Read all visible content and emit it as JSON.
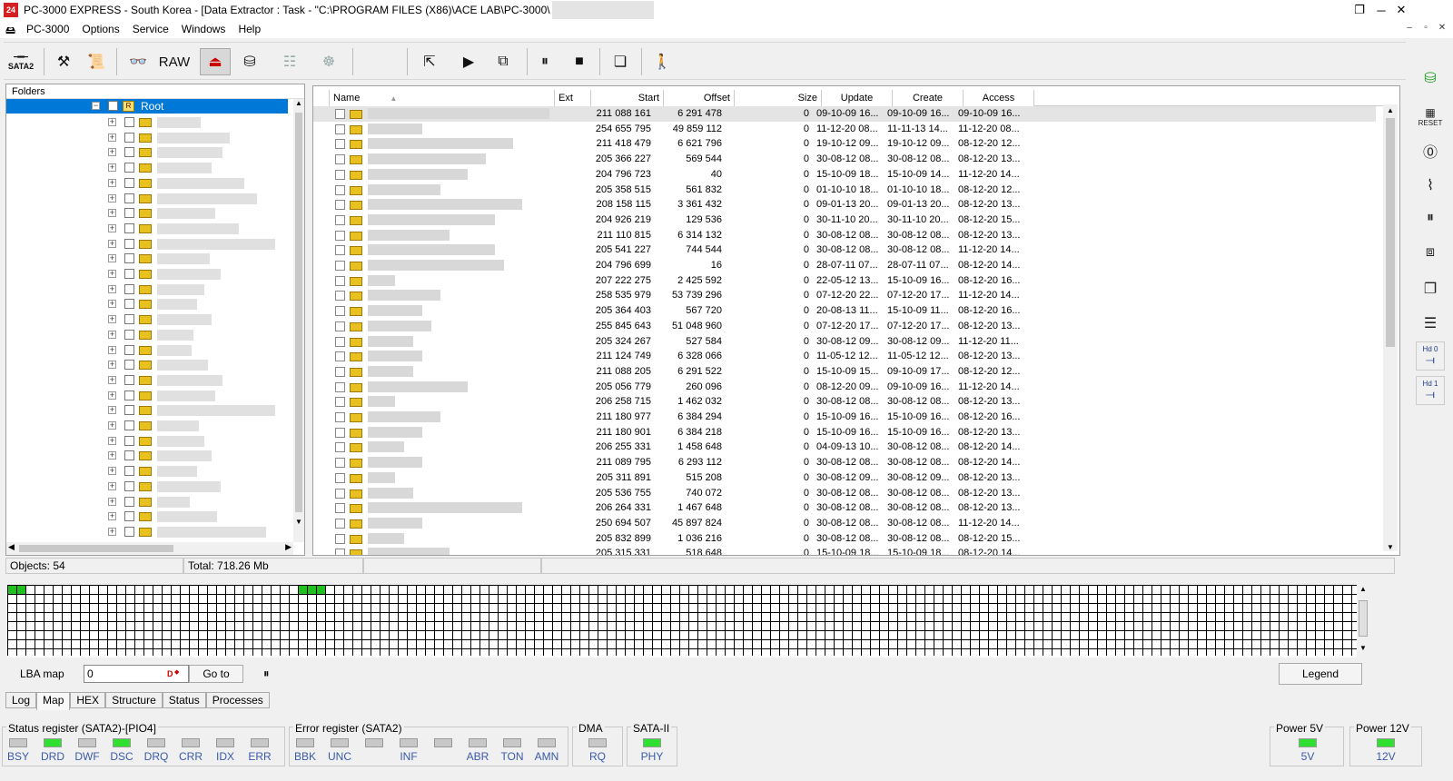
{
  "window": {
    "title": "PC-3000 EXPRESS - South Korea - [Data Extractor : Task - \"C:\\PROGRAM FILES (X86)\\ACE LAB\\PC-3000\\",
    "app_icon": "app-icon",
    "buttons": [
      "minimize",
      "restore",
      "close"
    ]
  },
  "menu": {
    "items": [
      "PC-3000",
      "Options",
      "Service",
      "Windows",
      "Help"
    ]
  },
  "toolbar": {
    "sata2_label": "SATA2",
    "raw_label": "RAW"
  },
  "right_toolbar": {
    "reset_label": "RESET",
    "hd0_label": "Hd 0",
    "hd1_label": "Hd 1"
  },
  "folders": {
    "header": "Folders",
    "root_label": "Root",
    "item_count": 29
  },
  "files": {
    "columns": [
      "Name",
      "Ext",
      "Start",
      "Offset",
      "Size",
      "Update",
      "Create",
      "Access"
    ],
    "rows": [
      [
        "211 088 161",
        "6 291 478",
        "0",
        "09-10-09 16...",
        "09-10-09 16...",
        "09-10-09 16..."
      ],
      [
        "254 655 795",
        "49 859 112",
        "0",
        "11-12-20 08...",
        "11-11-13 14...",
        "11-12-20 08..."
      ],
      [
        "211 418 479",
        "6 621 796",
        "0",
        "19-10-12 09...",
        "19-10-12 09...",
        "08-12-20 12..."
      ],
      [
        "205 366 227",
        "569 544",
        "0",
        "30-08-12 08...",
        "30-08-12 08...",
        "08-12-20 13..."
      ],
      [
        "204 796 723",
        "40",
        "0",
        "15-10-09 18...",
        "15-10-09 14...",
        "11-12-20 14..."
      ],
      [
        "205 358 515",
        "561 832",
        "0",
        "01-10-10 18...",
        "01-10-10 18...",
        "08-12-20 12..."
      ],
      [
        "208 158 115",
        "3 361 432",
        "0",
        "09-01-13 20...",
        "09-01-13 20...",
        "08-12-20 13..."
      ],
      [
        "204 926 219",
        "129 536",
        "0",
        "30-11-10 20...",
        "30-11-10 20...",
        "08-12-20 15..."
      ],
      [
        "211 110 815",
        "6 314 132",
        "0",
        "30-08-12 08...",
        "30-08-12 08...",
        "08-12-20 13..."
      ],
      [
        "205 541 227",
        "744 544",
        "0",
        "30-08-12 08...",
        "30-08-12 08...",
        "11-12-20 14..."
      ],
      [
        "204 796 699",
        "16",
        "0",
        "28-07-11 07...",
        "28-07-11 07...",
        "08-12-20 14..."
      ],
      [
        "207 222 275",
        "2 425 592",
        "0",
        "22-05-12 13...",
        "15-10-09 16...",
        "08-12-20 16..."
      ],
      [
        "258 535 979",
        "53 739 296",
        "0",
        "07-12-20 22...",
        "07-12-20 17...",
        "11-12-20 14..."
      ],
      [
        "205 364 403",
        "567 720",
        "0",
        "20-08-13 11...",
        "15-10-09 11...",
        "08-12-20 16..."
      ],
      [
        "255 845 643",
        "51 048 960",
        "0",
        "07-12-20 17...",
        "07-12-20 17...",
        "08-12-20 13..."
      ],
      [
        "205 324 267",
        "527 584",
        "0",
        "30-08-12 09...",
        "30-08-12 09...",
        "11-12-20 11..."
      ],
      [
        "211 124 749",
        "6 328 066",
        "0",
        "11-05-12 12...",
        "11-05-12 12...",
        "08-12-20 13..."
      ],
      [
        "211 088 205",
        "6 291 522",
        "0",
        "15-10-09 15...",
        "09-10-09 17...",
        "08-12-20 12..."
      ],
      [
        "205 056 779",
        "260 096",
        "0",
        "08-12-20 09...",
        "09-10-09 16...",
        "11-12-20 14..."
      ],
      [
        "206 258 715",
        "1 462 032",
        "0",
        "30-08-12 08...",
        "30-08-12 08...",
        "08-12-20 13..."
      ],
      [
        "211 180 977",
        "6 384 294",
        "0",
        "15-10-09 16...",
        "15-10-09 16...",
        "08-12-20 16..."
      ],
      [
        "211 180 901",
        "6 384 218",
        "0",
        "15-10-09 16...",
        "15-10-09 16...",
        "08-12-20 13..."
      ],
      [
        "206 255 331",
        "1 458 648",
        "0",
        "04-09-13 10...",
        "30-08-12 08...",
        "08-12-20 14..."
      ],
      [
        "211 089 795",
        "6 293 112",
        "0",
        "30-08-12 08...",
        "30-08-12 08...",
        "08-12-20 14..."
      ],
      [
        "205 311 891",
        "515 208",
        "0",
        "30-08-12 09...",
        "30-08-12 09...",
        "08-12-20 13..."
      ],
      [
        "205 536 755",
        "740 072",
        "0",
        "30-08-12 08...",
        "30-08-12 08...",
        "08-12-20 13..."
      ],
      [
        "206 264 331",
        "1 467 648",
        "0",
        "30-08-12 08...",
        "30-08-12 08...",
        "08-12-20 13..."
      ],
      [
        "250 694 507",
        "45 897 824",
        "0",
        "30-08-12 08...",
        "30-08-12 08...",
        "11-12-20 14..."
      ],
      [
        "205 832 899",
        "1 036 216",
        "0",
        "30-08-12 08...",
        "30-08-12 08...",
        "08-12-20 15..."
      ],
      [
        "205 315 331",
        "518 648",
        "0",
        "15-10-09 18...",
        "15-10-09 18...",
        "08-12-20 14..."
      ]
    ]
  },
  "status": {
    "objects": "Objects: 54",
    "total": "Total: 718.26 Mb"
  },
  "lba": {
    "label": "LBA map",
    "value": "0",
    "suffix": "D",
    "goto": "Go to",
    "legend": "Legend"
  },
  "tabs": [
    "Log",
    "Map",
    "HEX",
    "Structure",
    "Status",
    "Processes"
  ],
  "registers": {
    "status_title": "Status register (SATA2)-[PIO4]",
    "status_leds": [
      {
        "label": "BSY",
        "on": false
      },
      {
        "label": "DRD",
        "on": true
      },
      {
        "label": "DWF",
        "on": false
      },
      {
        "label": "DSC",
        "on": true
      },
      {
        "label": "DRQ",
        "on": false
      },
      {
        "label": "CRR",
        "on": false
      },
      {
        "label": "IDX",
        "on": false
      },
      {
        "label": "ERR",
        "on": false
      }
    ],
    "error_title": "Error register (SATA2)",
    "error_leds": [
      {
        "label": "BBK",
        "on": false
      },
      {
        "label": "UNC",
        "on": false
      },
      {
        "label": "",
        "on": false
      },
      {
        "label": "INF",
        "on": false
      },
      {
        "label": "",
        "on": false
      },
      {
        "label": "ABR",
        "on": false
      },
      {
        "label": "TON",
        "on": false
      },
      {
        "label": "AMN",
        "on": false
      }
    ],
    "dma_title": "DMA",
    "dma_led": {
      "label": "RQ",
      "on": false
    },
    "sata_title": "SATA-II",
    "sata_led": {
      "label": "PHY",
      "on": true
    },
    "power5_title": "Power 5V",
    "power5_led": {
      "label": "5V",
      "on": true
    },
    "power12_title": "Power 12V",
    "power12_led": {
      "label": "12V",
      "on": true
    }
  },
  "colors": {
    "selection": "#0078d7",
    "led_on": "#30e030",
    "led_label": "#3a5aa8",
    "folder": "#e8c020"
  }
}
